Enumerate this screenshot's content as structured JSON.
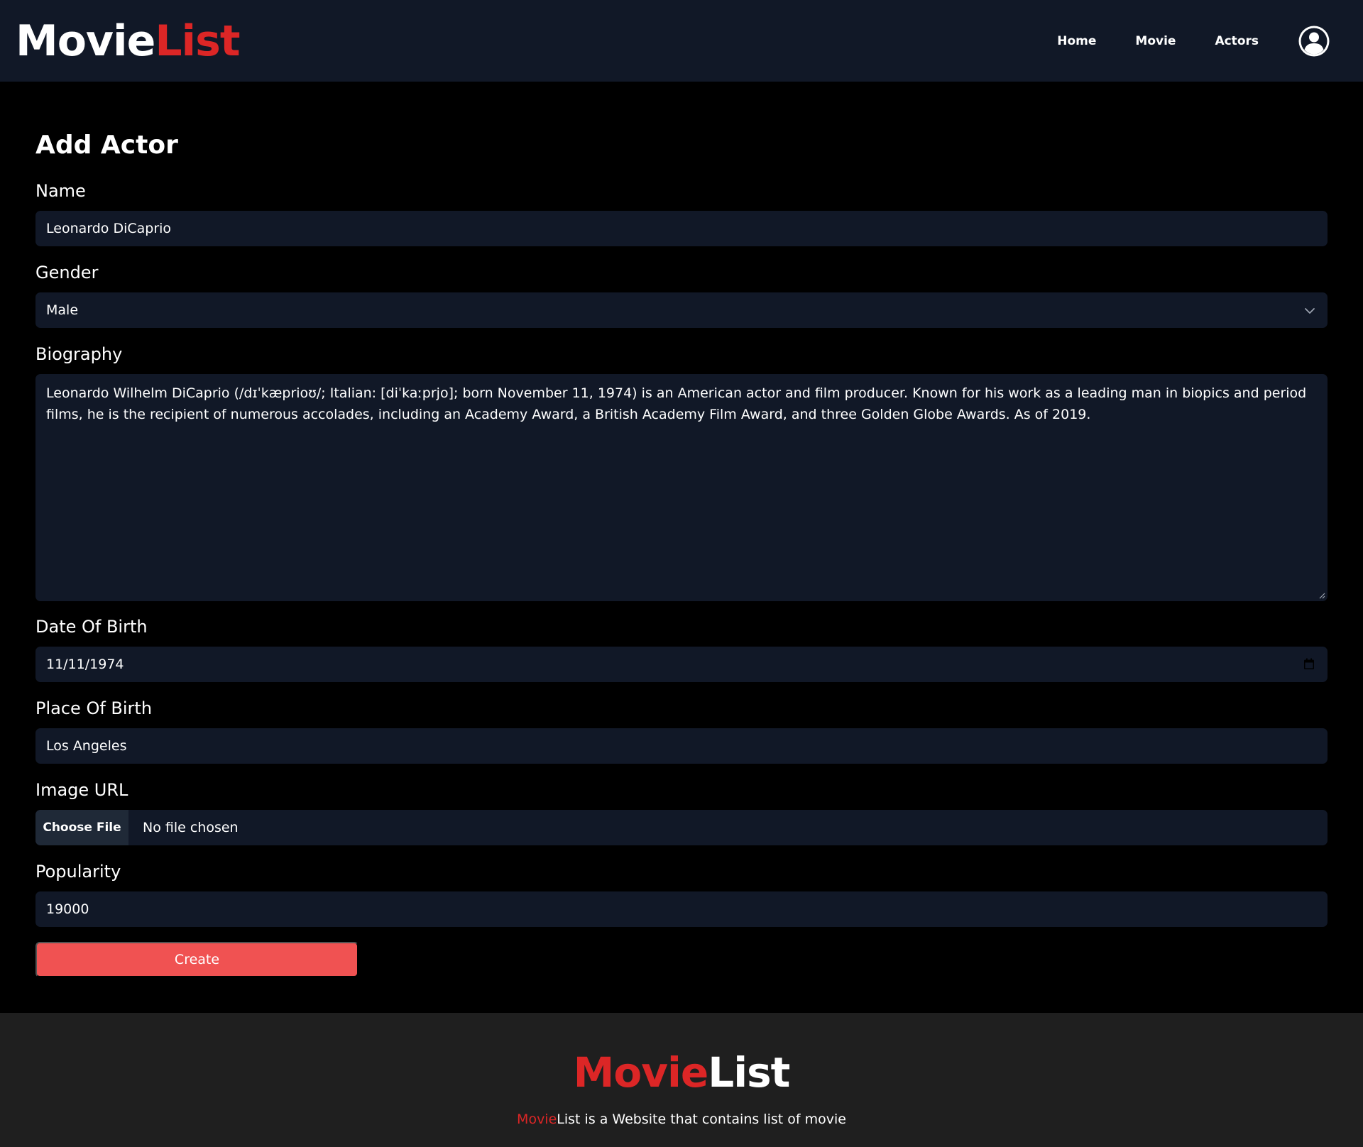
{
  "navbar": {
    "brand_part1": "Movie",
    "brand_part2": "List",
    "links": [
      "Home",
      "Movie",
      "Actors"
    ],
    "avatar_icon": "user-circle-icon"
  },
  "form": {
    "title": "Add Actor",
    "name": {
      "label": "Name",
      "value": "Leonardo DiCaprio"
    },
    "gender": {
      "label": "Gender",
      "value": "Male",
      "icon": "chevron-down-icon"
    },
    "biography": {
      "label": "Biography",
      "value": "Leonardo Wilhelm DiCaprio (/dɪˈkæprioʊ/; Italian: [diˈkaːprjo]; born November 11, 1974) is an American actor and film producer. Known for his work as a leading man in biopics and period films, he is the recipient of numerous accolades, including an Academy Award, a British Academy Film Award, and three Golden Globe Awards. As of 2019."
    },
    "date_of_birth": {
      "label": "Date Of Birth",
      "value": "11/11/1974",
      "icon": "calendar-icon"
    },
    "place_of_birth": {
      "label": "Place Of Birth",
      "value": "Los Angeles"
    },
    "image_url": {
      "label": "Image URL",
      "button": "Choose File",
      "status": "No file chosen"
    },
    "popularity": {
      "label": "Popularity",
      "value": "19000"
    },
    "submit": "Create"
  },
  "footer": {
    "brand_part1": "Movie",
    "brand_part2": "List",
    "tagline_accent": "Movie",
    "tagline_rest": "List is a Website that contains list of movie"
  },
  "colors": {
    "navbar_bg": "#111827",
    "input_bg": "#111827",
    "accent_red": "#dc2626",
    "button_red": "#f05252",
    "footer_bg": "#1f1f1f",
    "page_bg": "#000000"
  }
}
